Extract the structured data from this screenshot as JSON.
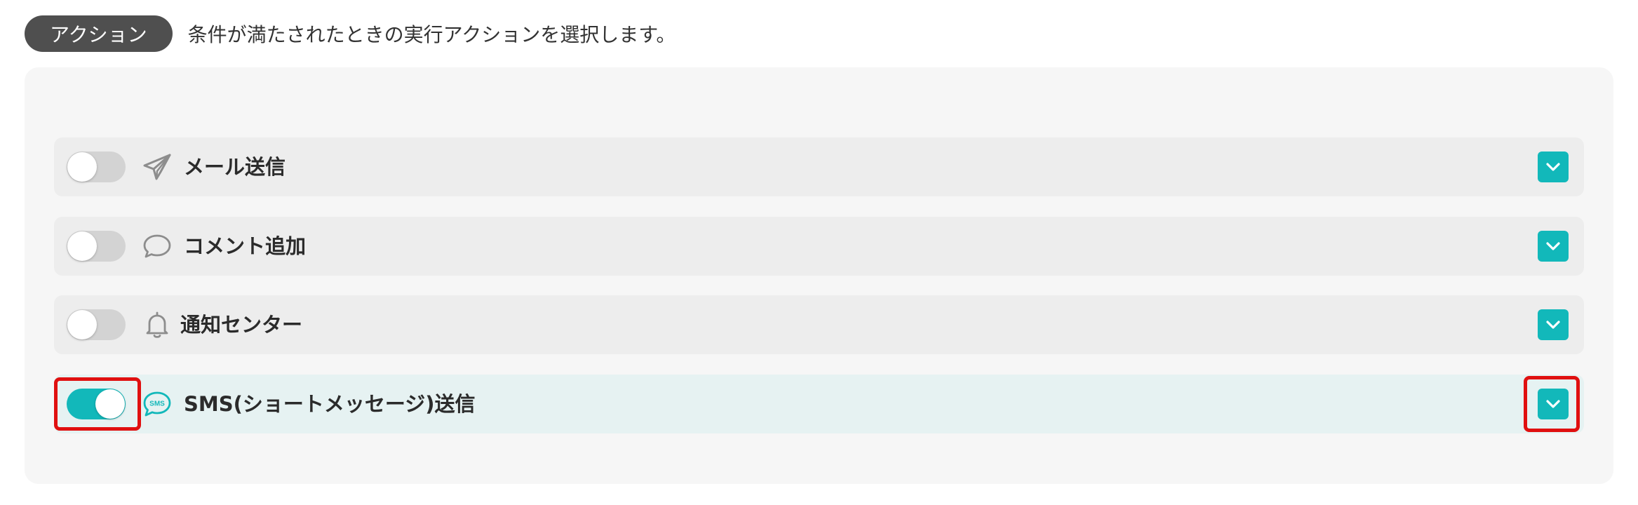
{
  "header": {
    "badge": "アクション",
    "description": "条件が満たされたときの実行アクションを選択します。"
  },
  "actions": [
    {
      "label": "メール送信",
      "icon": "paper-plane-icon",
      "enabled": false
    },
    {
      "label": "コメント追加",
      "icon": "speech-bubble-icon",
      "enabled": false
    },
    {
      "label": "通知センター",
      "icon": "bell-icon",
      "enabled": false
    },
    {
      "label": "SMS(ショートメッセージ)送信",
      "icon": "sms-bubble-icon",
      "enabled": true,
      "highlighted": true
    }
  ],
  "colors": {
    "accent": "#12b8ba",
    "highlight": "#e01010",
    "badge_bg": "#4f4f4f"
  }
}
